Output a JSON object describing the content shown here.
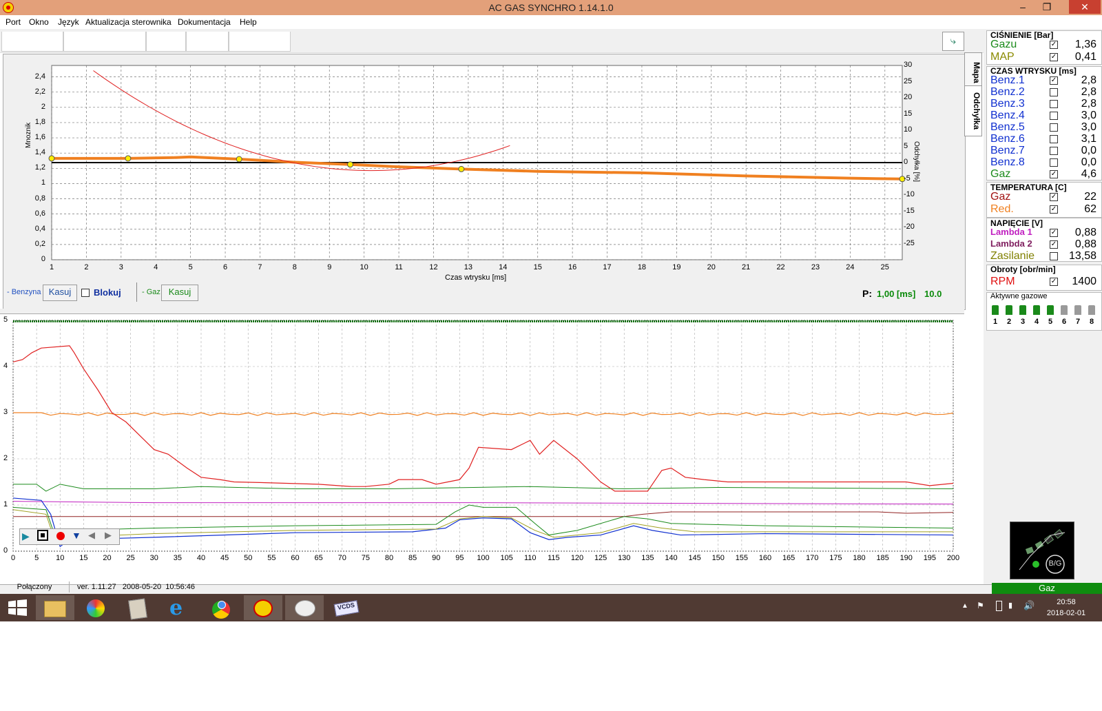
{
  "window": {
    "title": "AC GAS SYNCHRO     1.14.1.0"
  },
  "menu": [
    "Port",
    "Okno",
    "Język",
    "Aktualizacja sterownika",
    "Dokumentacja",
    "Help"
  ],
  "side_tabs": [
    "Mapa",
    "Odchyłka"
  ],
  "upper_chart": {
    "ylabel_left": "Mnoznik",
    "ylabel_right": "Odchyłka [%]",
    "xlabel": "Czas wtrysku [ms]",
    "left_ticks": [
      "2,4",
      "2,2",
      "2",
      "1,8",
      "1,6",
      "1,4",
      "1,2",
      "1",
      "0,8",
      "0,6",
      "0,4",
      "0,2",
      "0"
    ],
    "right_ticks": [
      "30",
      "25",
      "20",
      "15",
      "10",
      "5",
      "0",
      "-5",
      "-10",
      "-15",
      "-20",
      "-25"
    ],
    "x_ticks": [
      "1",
      "2",
      "3",
      "4",
      "5",
      "6",
      "7",
      "8",
      "9",
      "10",
      "11",
      "12",
      "13",
      "14",
      "15",
      "16",
      "17",
      "18",
      "19",
      "20",
      "21",
      "22",
      "23",
      "24",
      "25"
    ]
  },
  "controls": {
    "benzyna_label": "- Benzyna",
    "kasuj1": "Kasuj",
    "blokuj": "Blokuj",
    "gaz_label": "- Gaz",
    "kasuj2": "Kasuj",
    "p_label": "P:",
    "p_value": "1,00 [ms]",
    "p_value2": "10.0"
  },
  "lower_chart": {
    "y_ticks": [
      "5",
      "4",
      "3",
      "2",
      "1",
      "0"
    ],
    "x_ticks": [
      "0",
      "5",
      "10",
      "15",
      "20",
      "25",
      "30",
      "35",
      "40",
      "45",
      "50",
      "55",
      "60",
      "65",
      "70",
      "75",
      "80",
      "85",
      "90",
      "95",
      "100",
      "105",
      "110",
      "115",
      "120",
      "125",
      "130",
      "135",
      "140",
      "145",
      "150",
      "155",
      "160",
      "165",
      "170",
      "175",
      "180",
      "185",
      "190",
      "195",
      "200"
    ]
  },
  "right_panel": {
    "cisnienie": {
      "header": "CIŚNIENIE [Bar]",
      "rows": [
        {
          "label": "Gazu",
          "checked": true,
          "value": "1,36",
          "color": "#1a8a1a"
        },
        {
          "label": "MAP",
          "checked": true,
          "value": "0,41",
          "color": "#8a8a00"
        }
      ]
    },
    "czas": {
      "header": "CZAS WTRYSKU  [ms]",
      "rows": [
        {
          "label": "Benz.1",
          "checked": true,
          "value": "2,8",
          "color": "#1030d0"
        },
        {
          "label": "Benz.2",
          "checked": false,
          "value": "2,8",
          "color": "#1030d0"
        },
        {
          "label": "Benz.3",
          "checked": false,
          "value": "2,8",
          "color": "#1030d0"
        },
        {
          "label": "Benz.4",
          "checked": false,
          "value": "3,0",
          "color": "#1030d0"
        },
        {
          "label": "Benz.5",
          "checked": false,
          "value": "3,0",
          "color": "#1030d0"
        },
        {
          "label": "Benz.6",
          "checked": false,
          "value": "3,1",
          "color": "#1030d0"
        },
        {
          "label": "Benz.7",
          "checked": false,
          "value": "0,0",
          "color": "#1030d0"
        },
        {
          "label": "Benz.8",
          "checked": false,
          "value": "0,0",
          "color": "#1030d0"
        },
        {
          "label": "Gaz",
          "checked": true,
          "value": "4,6",
          "color": "#1a8a1a"
        }
      ]
    },
    "temperatura": {
      "header": "TEMPERATURA  [C]",
      "rows": [
        {
          "label": "Gaz",
          "checked": true,
          "value": "22",
          "color": "#a01010"
        },
        {
          "label": "Red.",
          "checked": true,
          "value": "62",
          "color": "#f08020"
        }
      ]
    },
    "napiecie": {
      "header": "NAPIĘCIE [V]",
      "rows": [
        {
          "label": "Lambda 1",
          "checked": true,
          "value": "0,88",
          "color": "#c020c0"
        },
        {
          "label": "Lambda 2",
          "checked": true,
          "value": "0,88",
          "color": "#802060"
        },
        {
          "label": "Zasilanie",
          "checked": false,
          "value": "13,58",
          "color": "#808000"
        }
      ]
    },
    "obroty": {
      "header": "Obroty [obr/min]",
      "rows": [
        {
          "label": "RPM",
          "checked": true,
          "value": "1400",
          "color": "#e01010"
        }
      ]
    },
    "aktywne": {
      "header": "Aktywne gazowe",
      "items": [
        "1",
        "2",
        "3",
        "4",
        "5",
        "6",
        "7",
        "8"
      ]
    },
    "bg_label": "B/G"
  },
  "status": {
    "state": "Połączony",
    "version": "ver. 1.11.27   2008-05-20  10:56:46",
    "mode": "Gaz"
  },
  "taskbar": {
    "time": "20:58",
    "date": "2018-02-01"
  }
}
